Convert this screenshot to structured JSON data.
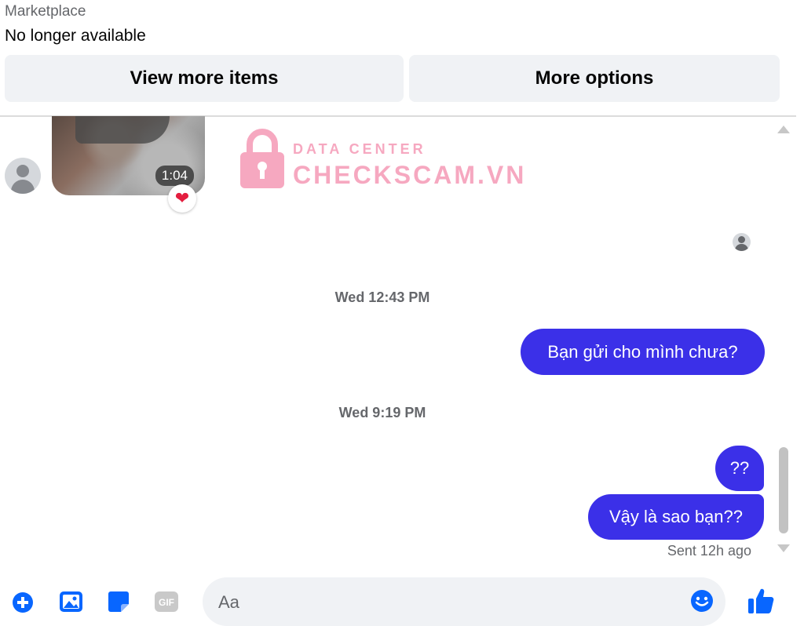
{
  "marketplace": {
    "label": "Marketplace",
    "status": "No longer available",
    "view_more_label": "View more items",
    "more_options_label": "More options"
  },
  "video": {
    "duration": "1:04",
    "reaction": "❤"
  },
  "watermark": {
    "top_text": "DATA CENTER",
    "main_text": "CHECKSCAM.VN"
  },
  "conversation": {
    "timestamp1": "Wed 12:43 PM",
    "message1": "Bạn gửi cho mình chưa?",
    "timestamp2": "Wed 9:19 PM",
    "message2": "??",
    "message3": "Vậy là sao bạn??",
    "sent_status": "Sent 12h ago"
  },
  "composer": {
    "placeholder": "Aa",
    "icons": [
      "plus-circle-icon",
      "image-icon",
      "sticker-icon",
      "gif-icon",
      "emoji-icon",
      "thumbs-up-icon"
    ]
  },
  "colors": {
    "accent": "#0866ff",
    "bubble": "#3b30e8",
    "watermark": "#f6a8c0"
  }
}
